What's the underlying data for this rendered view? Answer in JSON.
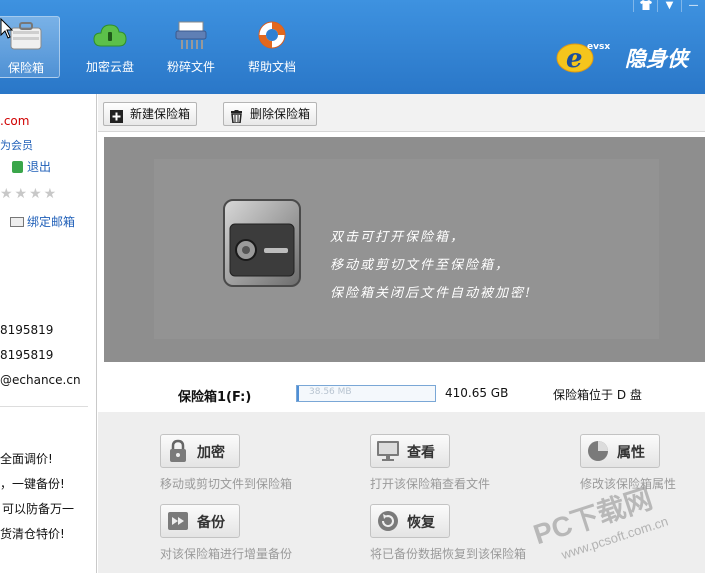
{
  "window": {
    "controls": [
      "▼",
      "—"
    ]
  },
  "toolbar": {
    "items": [
      {
        "label": "保险箱",
        "icon": "safe-box-icon",
        "active": true
      },
      {
        "label": "加密云盘",
        "icon": "cloud-lock-icon",
        "active": false
      },
      {
        "label": "粉碎文件",
        "icon": "shredder-icon",
        "active": false
      },
      {
        "label": "帮助文档",
        "icon": "lifebuoy-icon",
        "active": false
      }
    ],
    "brand": "隐身侠",
    "brand_prefix": "evsx"
  },
  "sidebar": {
    "email_fragment": ".com",
    "member_fragment": "为会员",
    "logout_label": "退出",
    "stars": "★★★★",
    "bind_email_label": "绑定邮箱",
    "phone1": "8195819",
    "phone2": "8195819",
    "email2_fragment": "@echance.cn",
    "promo": [
      "全面调价!",
      "，一键备份!",
      "可以防备万一",
      "货清仓特价!"
    ]
  },
  "actions": {
    "new_vault": "新建保险箱",
    "delete_vault": "删除保险箱"
  },
  "vault": {
    "messages": [
      "双击可打开保险箱，",
      "移动或剪切文件至保险箱，",
      "保险箱关闭后文件自动被加密!"
    ],
    "name": "保险箱1(F:)",
    "used": "38.56 MB",
    "used_fraction": 0.012,
    "capacity": "410.65 GB",
    "location": "保险箱位于 D 盘"
  },
  "operations": [
    {
      "label": "加密",
      "icon": "lock-icon",
      "desc": "移动或剪切文件到保险箱"
    },
    {
      "label": "查看",
      "icon": "monitor-icon",
      "desc": "打开该保险箱查看文件"
    },
    {
      "label": "属性",
      "icon": "pie-chart-icon",
      "desc": "修改该保险箱属性"
    },
    {
      "label": "备份",
      "icon": "backup-icon",
      "desc": "对该保险箱进行增量备份"
    },
    {
      "label": "恢复",
      "icon": "restore-icon",
      "desc": "将已备份数据恢复到该保险箱"
    }
  ],
  "watermark": {
    "line1": "PC下载网",
    "line2": "www.pcsoft.com.cn"
  },
  "colors": {
    "topbar": "#2f80d2",
    "vault_bg": "#8e8e8e",
    "link_blue": "#1f5fb8",
    "alert_red": "#d00000"
  }
}
